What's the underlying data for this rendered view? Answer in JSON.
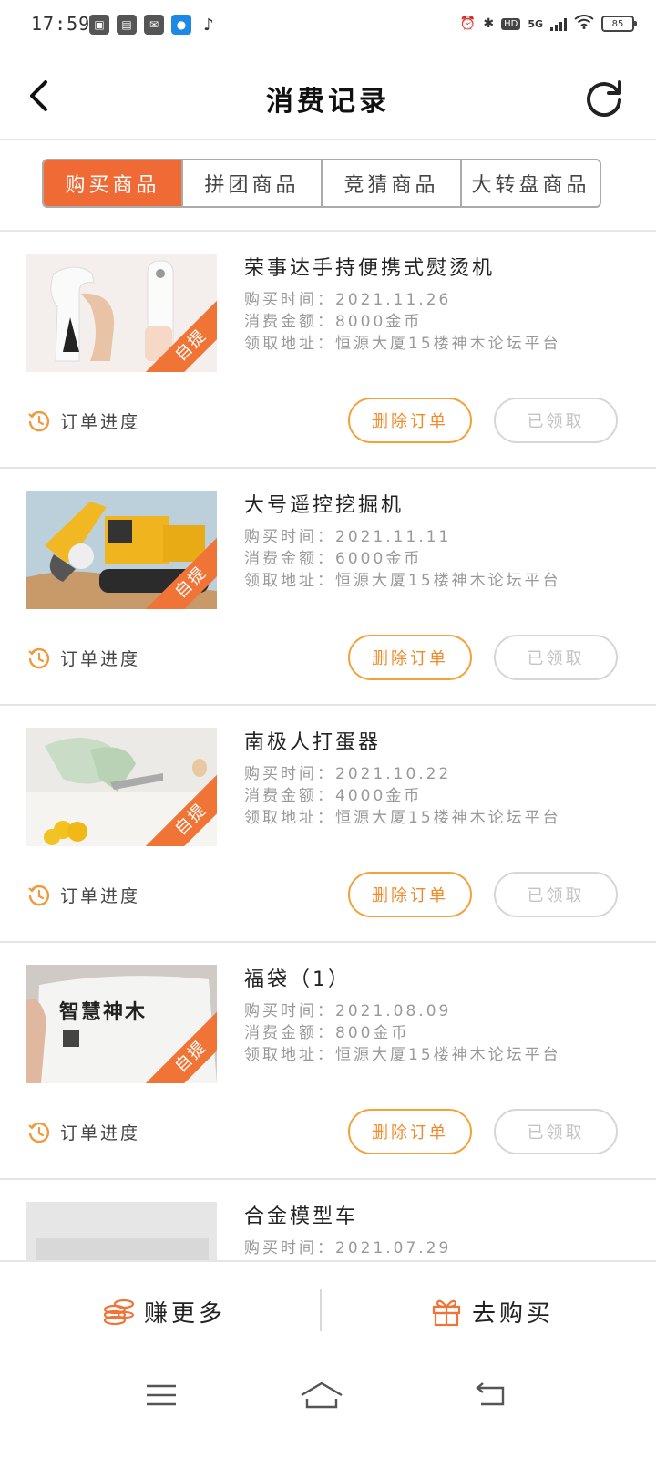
{
  "status_bar": {
    "time": "17:59",
    "battery": "85",
    "network": "5G",
    "hd": "HD",
    "left_icons": [
      "sim-icon",
      "movie-app-icon",
      "mail-icon",
      "baidu-icon",
      "tiktok-icon"
    ],
    "right_icons": [
      "alarm-icon",
      "bluetooth-icon",
      "hd-icon",
      "signal-icon",
      "wifi-icon",
      "battery-icon"
    ]
  },
  "header": {
    "title": "消费记录"
  },
  "tabs": [
    {
      "label": "购买商品",
      "active": true
    },
    {
      "label": "拼团商品",
      "active": false
    },
    {
      "label": "竞猜商品",
      "active": false
    },
    {
      "label": "大转盘商品",
      "active": false
    }
  ],
  "orders": [
    {
      "name": "荣事达手持便携式熨烫机",
      "time_line": "购买时间：2021.11.26",
      "amount_line": "消费金额：8000金币",
      "address_line": "领取地址：恒源大厦15楼神木论坛平台",
      "badge": "自提",
      "progress": "订单进度",
      "delete": "删除订单",
      "status": "已领取"
    },
    {
      "name": "大号遥控挖掘机",
      "time_line": "购买时间：2021.11.11",
      "amount_line": "消费金额：6000金币",
      "address_line": "领取地址：恒源大厦15楼神木论坛平台",
      "badge": "自提",
      "progress": "订单进度",
      "delete": "删除订单",
      "status": "已领取"
    },
    {
      "name": "南极人打蛋器",
      "time_line": "购买时间：2021.10.22",
      "amount_line": "消费金额：4000金币",
      "address_line": "领取地址：恒源大厦15楼神木论坛平台",
      "badge": "自提",
      "progress": "订单进度",
      "delete": "删除订单",
      "status": "已领取"
    },
    {
      "name": "福袋（1）",
      "time_line": "购买时间：2021.08.09",
      "amount_line": "消费金额：800金币",
      "address_line": "领取地址：恒源大厦15楼神木论坛平台",
      "badge": "自提",
      "progress": "订单进度",
      "delete": "删除订单",
      "status": "已领取",
      "bag_text": "智慧神木"
    },
    {
      "name": "合金模型车",
      "time_line": "购买时间：2021.07.29",
      "amount_line": "",
      "address_line": "",
      "badge": "",
      "progress": "",
      "delete": "",
      "status": ""
    }
  ],
  "bottom_bar": {
    "earn": "赚更多",
    "buy": "去购买"
  },
  "colors": {
    "accent": "#f06a35",
    "button_border": "#f5a13a",
    "muted": "#999999"
  }
}
